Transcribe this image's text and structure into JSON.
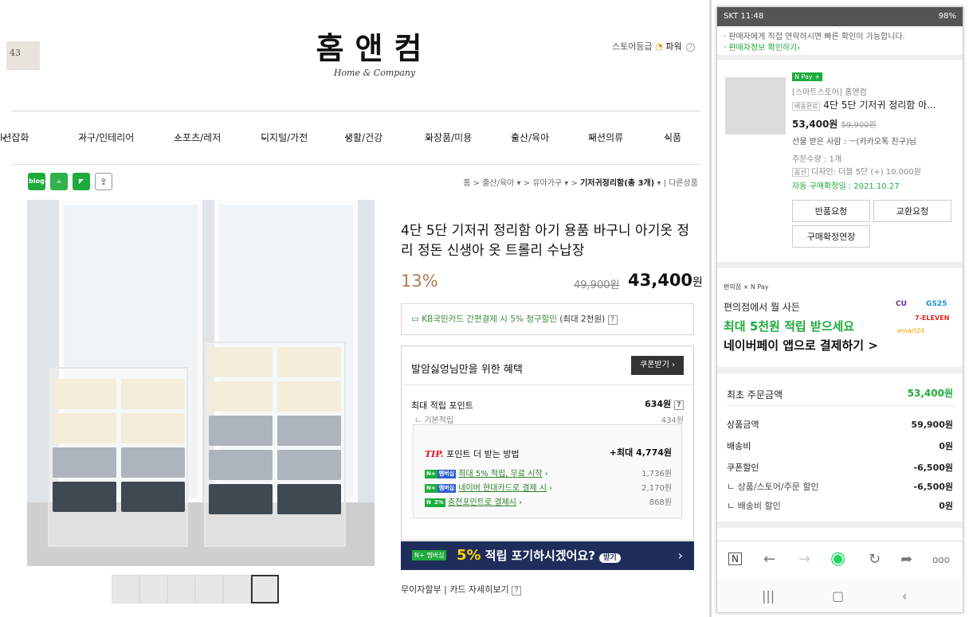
{
  "left_panel": {
    "header": {
      "thumb_text": "43",
      "logo_korean": "홈앤컴",
      "logo_english": "Home & Company",
      "store_grade_label": "스토어등급",
      "store_grade_value": "파워"
    },
    "nav_items": [
      "l션잡화",
      "가구/인테리어",
      "스포츠/레저",
      "디지털/가전",
      "생활/건강",
      "화장품/미용",
      "출산/육아",
      "패션의류",
      "식품"
    ],
    "breadcrumb": {
      "home": "홈",
      "level1": "출산/육아",
      "level2": "유아가구",
      "current": "기저귀정리함(총 3개)",
      "more": "다른상품"
    },
    "product": {
      "title": "4단 5단 기저귀 정리함 아기 용품 바구니 아기옷 정리 정돈 신생아 옷 트롤리 수납장",
      "discount": "13%",
      "original_price": "49,900원",
      "sale_price": "43,400",
      "won": "원",
      "card_promo": "KB국민카드 간편결제 시 5% 청구할인",
      "card_promo_extra": "(최대 2천원)"
    },
    "benefit": {
      "title": "발암싫엉님만을 위한 혜택",
      "coupon_button": "쿠폰받기",
      "max_point_label": "최대 적립 포인트",
      "max_point_value": "634원",
      "basic_label": "기본적립",
      "basic_value": "434원",
      "tip_label": "TIP.",
      "tip_title": "포인트 더 받는 방법",
      "tip_max": "+최대 4,774원",
      "tip_rows": [
        {
          "badge": "멤버십",
          "text": "최대 5% 적립, 무료 시작",
          "value": "1,736원"
        },
        {
          "badge": "멤버십",
          "text": "네이버 현대카드로 결제 시",
          "value": "2,170원"
        },
        {
          "badge": "2%",
          "text": "충전포인트로 결제시",
          "value": "868원"
        }
      ]
    },
    "npay_banner": {
      "pre": "N+ 멤버십",
      "highlight": "5%",
      "text": "적립 포기하시겠어요?",
      "chip": "받기",
      "arrow": "›"
    },
    "footer_links": [
      "무이자할부",
      "카드 자세히보기"
    ]
  },
  "right_panel": {
    "status_bar": {
      "time": "SKT 11:48",
      "battery": "98%"
    },
    "seller_note": "· 판매자에게 직접 연락하시면 빠른 확인이 가능합니다.",
    "seller_link": "· 판매자정보 확인하기›",
    "npay_label": "N Pay +",
    "store": "[스마트스토어] 홈앤컴",
    "item_badge": "배송완료",
    "item_name": "4단 5단 기저귀 정리함 아...",
    "item_price": "53,400원",
    "item_orig": "59,900원",
    "gift_to": "선물 받은 사람 : ㅡ(카카오톡 친구)님",
    "qty": "주문수량 : 1개",
    "option_label": "옵션",
    "option": "디자인: 더블 5단 (+) 10,000원",
    "auto_confirm": "자동 구매확정일 : 2021.10.27",
    "buttons": [
      "반품요청",
      "교환요청",
      "구매확정연장"
    ],
    "cvs_brand": "편의점 × N Pay",
    "cvs_line1": "편의점에서 뭘 사든",
    "cvs_line2": "최대 5천원 적립 받으세요",
    "cvs_line3": "네이버페이 앱으로 결제하기 >",
    "cvs_stores": [
      "CU",
      "GS25",
      "7-ELEVEN",
      "emart24"
    ],
    "summary": [
      {
        "label": "최초 주문금액",
        "value": "53,400원"
      },
      {
        "label": "상품금액",
        "value": "59,900원"
      },
      {
        "label": "배송비",
        "value": "0원"
      },
      {
        "label": "쿠폰할인",
        "value": "-6,500원"
      },
      {
        "label": "ㄴ 상품/스토어/주문 할인",
        "value": "-6,500원"
      },
      {
        "label": "ㄴ 배송비 할인",
        "value": "0원"
      }
    ],
    "colors": {
      "green": "#1eab3c",
      "navy": "#1f2d5c",
      "price_brown": "#b37c54"
    }
  }
}
